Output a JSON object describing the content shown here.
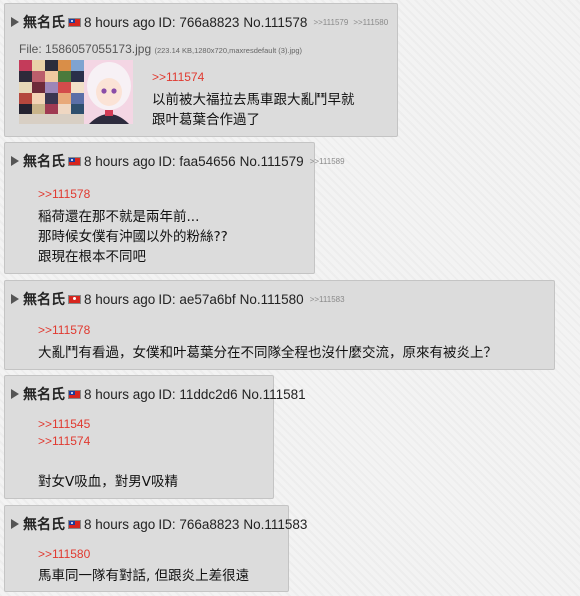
{
  "posts": [
    {
      "name": "無名氏",
      "time": "8 hours ago",
      "id": "ID: 766a8823",
      "no": "No.111578",
      "backlinks": [
        ">>111579",
        ">>111580"
      ],
      "file": {
        "label": "File:",
        "name": "1586057055173.jpg",
        "info": "(223.14 KB,1280x720,maxresdefault (3).jpg)"
      },
      "quotes": [
        ">>111574"
      ],
      "lines": [
        "以前被大福拉去馬車跟大亂鬥早就",
        "跟叶葛葉合作過了"
      ]
    },
    {
      "name": "無名氏",
      "time": "8 hours ago",
      "id": "ID: faa54656",
      "no": "No.111579",
      "backlinks": [
        ">>111589"
      ],
      "quotes": [
        ">>111578"
      ],
      "lines": [
        "稲荷還在那不就是兩年前...",
        "那時候女僕有沖國以外的粉絲??",
        "跟現在根本不同吧"
      ]
    },
    {
      "name": "無名氏",
      "time": "8 hours ago",
      "id": "ID: ae57a6bf",
      "no": "No.111580",
      "backlinks": [
        ">>111583"
      ],
      "quotes": [
        ">>111578"
      ],
      "lines": [
        "大亂鬥有看過，女僕和叶葛葉分在不同隊全程也沒什麼交流，原來有被炎上？"
      ]
    },
    {
      "name": "無名氏",
      "time": "8 hours ago",
      "id": "ID: 11ddc2d6",
      "no": "No.111581",
      "backlinks": [],
      "quotes": [
        ">>111545",
        ">>111574"
      ],
      "lines": [
        "對女V吸血，對男V吸精"
      ]
    },
    {
      "name": "無名氏",
      "time": "8 hours ago",
      "id": "ID: 766a8823",
      "no": "No.111583",
      "backlinks": [],
      "quotes": [
        ">>111580"
      ],
      "lines": [
        "馬車同一隊有對話, 但跟炎上差很遠"
      ]
    }
  ]
}
